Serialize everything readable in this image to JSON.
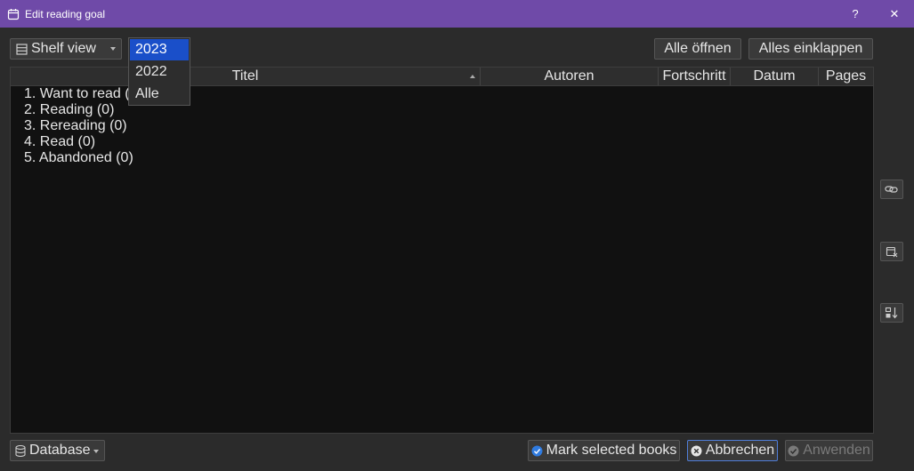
{
  "window": {
    "title": "Edit reading goal",
    "help_label": "?",
    "close_label": "✕"
  },
  "toolbar": {
    "view_label": "Shelf view",
    "open_all_label": "Alle öffnen",
    "collapse_all_label": "Alles einklappen"
  },
  "year_dropdown": {
    "options": [
      "2023",
      "2022",
      "Alle"
    ],
    "selected": "2023"
  },
  "table": {
    "columns": [
      "Titel",
      "Autoren",
      "Fortschritt",
      "Datum",
      "Pages"
    ],
    "sorted_column": "Titel",
    "rows": [
      "1. Want to read (0)",
      "2. Reading (0)",
      "3. Rereading (0)",
      "4. Read (0)",
      "5. Abandoned (0)"
    ]
  },
  "side_buttons": [
    {
      "icon": "link-icon"
    },
    {
      "icon": "calendar-remove-icon"
    },
    {
      "icon": "sort-down-icon"
    }
  ],
  "footer": {
    "database_label": "Database",
    "mark_label": "Mark selected books",
    "cancel_label": "Abbrechen",
    "apply_label": "Anwenden"
  },
  "colors": {
    "titlebar": "#6f4aa8",
    "selection": "#1a4fc9",
    "background": "#2b2b2b",
    "table_bg": "#111111"
  }
}
